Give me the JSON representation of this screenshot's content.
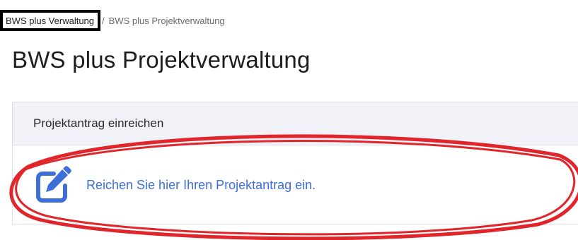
{
  "breadcrumb": {
    "current": "BWS plus Verwaltung",
    "separator": "/",
    "link": "BWS plus Projektverwaltung"
  },
  "page": {
    "title": "BWS plus Projektverwaltung"
  },
  "card": {
    "header": "Projektantrag einreichen",
    "action_label": "Reichen Sie hier Ihren Projektantrag ein.",
    "action_icon": "edit-icon"
  },
  "colors": {
    "accent": "#3d6fd9",
    "annotation": "#e0252b",
    "highlight_box": "#000000",
    "card_header_bg": "#f0f2f8"
  }
}
